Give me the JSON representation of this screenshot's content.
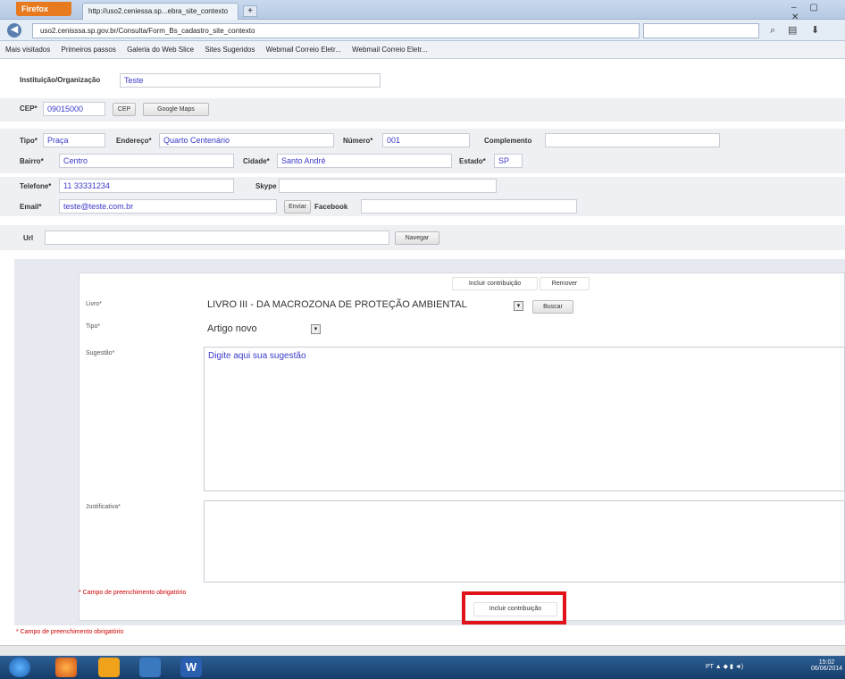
{
  "browser": {
    "firefox_label": "Firefox",
    "tab_title": "http://uso2.ceniessa.sp...ebra_site_contexto",
    "new_tab": "+",
    "window_controls": "– ▢ ✕",
    "url": "uso2.cenisssa.sp.gov.br/Consulta/Form_Bs_cadastro_site_contexto",
    "bookmarks": [
      "Mais visitados",
      "Primeiros passos",
      "Galeria do Web Slice",
      "Sites Sugeridos",
      "Webmail Correio Eletr...",
      "Webmail Correio Eletr..."
    ]
  },
  "form": {
    "instituicao_label": "Instituição/Organização",
    "instituicao_value": "Teste",
    "cep_label": "CEP*",
    "cep_value": "09015000",
    "cep_button": "CEP",
    "google_maps_button": "Google Maps",
    "tipo_label": "Tipo*",
    "tipo_value": "Praça",
    "endereco_label": "Endereço*",
    "endereco_value": "Quarto Centenário",
    "numero_label": "Número*",
    "numero_value": "001",
    "complemento_label": "Complemento",
    "complemento_value": "",
    "bairro_label": "Bairro*",
    "bairro_value": "Centro",
    "cidade_label": "Cidade*",
    "cidade_value": "Santo André",
    "estado_label": "Estado*",
    "estado_value": "SP",
    "telefone_label": "Telefone*",
    "telefone_value": "11 33331234",
    "skype_label": "Skype",
    "skype_value": "",
    "email_label": "Email*",
    "email_value": "teste@teste.com.br",
    "enviar_button": "Enviar",
    "facebook_label": "Facebook",
    "facebook_value": "",
    "url_label": "Url",
    "url_value": "",
    "navegar_button": "Navegar",
    "required_note": "* Campo de preenchimento obrigatório"
  },
  "contribution": {
    "incluir_top": "Incluir contribuição",
    "remover": "Remover",
    "livro_label": "Livro*",
    "livro_value": "LIVRO III - DA MACROZONA DE PROTEÇÃO AMBIENTAL",
    "buscar_button": "Buscar",
    "tipo_label": "Tipo*",
    "tipo_value": "Artigo novo",
    "sugestao_label": "Sugestão*",
    "sugestao_value": "Digite aqui sua sugestão",
    "justificativa_label": "Justificativa*",
    "justificativa_value": "",
    "required_note": "* Campo de preenchimento obrigatório",
    "incluir_bottom": "Incluir contribuição"
  },
  "taskbar": {
    "tray_text": "PT ▲ ◆ ▮ ◄)",
    "clock_time": "15:02",
    "clock_date": "06/06/2014"
  }
}
